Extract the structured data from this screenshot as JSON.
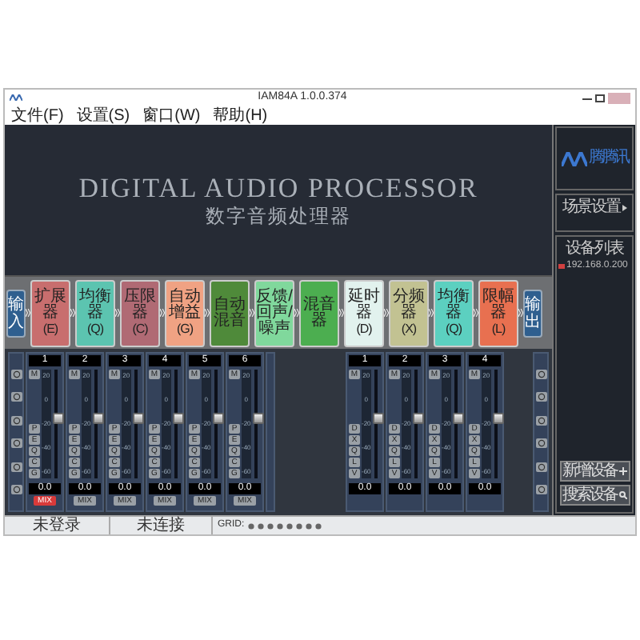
{
  "window": {
    "title": "IAM84A 1.0.0.374"
  },
  "menu": [
    "文件(F)",
    "设置(S)",
    "窗口(W)",
    "帮助(H)"
  ],
  "splash": {
    "title": "DIGITAL AUDIO PROCESSOR",
    "subtitle": "数字音频处理器"
  },
  "chain": [
    {
      "kind": "io",
      "label": "输入",
      "color": "#2f5f8f"
    },
    {
      "kind": "module",
      "label": "扩展器",
      "key": "(E)",
      "color": "#c86e6e"
    },
    {
      "kind": "module",
      "label": "均衡器",
      "key": "(Q)",
      "color": "#5cc4b0"
    },
    {
      "kind": "module",
      "label": "压限器",
      "key": "(C)",
      "color": "#b06a74"
    },
    {
      "kind": "module",
      "label": "自动增益",
      "key": "(G)",
      "color": "#f0a283"
    },
    {
      "kind": "module",
      "label": "自动混音",
      "color": "#4f8a3a"
    },
    {
      "kind": "module",
      "label": "反馈/回声/噪声",
      "color": "#80d89c"
    },
    {
      "kind": "module",
      "label": "混音器",
      "color": "#4cae50"
    },
    {
      "kind": "module",
      "label": "延时器",
      "key": "(D)",
      "color": "#e2f2ee"
    },
    {
      "kind": "module",
      "label": "分频器",
      "key": "(X)",
      "color": "#c2c292"
    },
    {
      "kind": "module",
      "label": "均衡器",
      "key": "(Q)",
      "color": "#5cd0c0"
    },
    {
      "kind": "module",
      "label": "限幅器",
      "key": "(L)",
      "color": "#e87050"
    },
    {
      "kind": "io",
      "label": "输出",
      "color": "#2f5f8f"
    }
  ],
  "inputs": [
    {
      "number": "1",
      "mute": "M",
      "scale": [
        "20",
        "0",
        "-20",
        "-40",
        "-60"
      ],
      "buttons": [
        "P",
        "E",
        "Q",
        "C",
        "G"
      ],
      "level": 0.55,
      "value": "0.0",
      "mix": "MIX",
      "mix_on": true
    },
    {
      "number": "2",
      "mute": "M",
      "scale": [
        "20",
        "0",
        "-20",
        "-40",
        "-60"
      ],
      "buttons": [
        "P",
        "E",
        "Q",
        "C",
        "G"
      ],
      "level": 0.55,
      "value": "0.0",
      "mix": "MIX",
      "mix_on": false
    },
    {
      "number": "3",
      "mute": "M",
      "scale": [
        "20",
        "0",
        "-20",
        "-40",
        "-60"
      ],
      "buttons": [
        "P",
        "E",
        "Q",
        "C",
        "G"
      ],
      "level": 0.55,
      "value": "0.0",
      "mix": "MIX",
      "mix_on": false
    },
    {
      "number": "4",
      "mute": "M",
      "scale": [
        "20",
        "0",
        "-20",
        "-40",
        "-60"
      ],
      "buttons": [
        "P",
        "E",
        "Q",
        "C",
        "G"
      ],
      "level": 0.55,
      "value": "0.0",
      "mix": "MIX",
      "mix_on": false
    },
    {
      "number": "5",
      "mute": "M",
      "scale": [
        "20",
        "0",
        "-20",
        "-40",
        "-60"
      ],
      "buttons": [
        "P",
        "E",
        "Q",
        "C",
        "G"
      ],
      "level": 0.55,
      "value": "0.0",
      "mix": "MIX",
      "mix_on": false
    },
    {
      "number": "6",
      "mute": "M",
      "scale": [
        "20",
        "0",
        "-20",
        "-40",
        "-60"
      ],
      "buttons": [
        "P",
        "E",
        "Q",
        "C",
        "G"
      ],
      "level": 0.55,
      "value": "0.0",
      "mix": "MIX",
      "mix_on": false
    }
  ],
  "outputs": [
    {
      "number": "1",
      "mute": "M",
      "scale": [
        "20",
        "0",
        "-20",
        "-40",
        "-60"
      ],
      "buttons": [
        "D",
        "X",
        "Q",
        "L",
        "V"
      ],
      "level": 0.55,
      "value": "0.0"
    },
    {
      "number": "2",
      "mute": "M",
      "scale": [
        "20",
        "0",
        "-20",
        "-40",
        "-60"
      ],
      "buttons": [
        "D",
        "X",
        "Q",
        "L",
        "V"
      ],
      "level": 0.55,
      "value": "0.0"
    },
    {
      "number": "3",
      "mute": "M",
      "scale": [
        "20",
        "0",
        "-20",
        "-40",
        "-60"
      ],
      "buttons": [
        "D",
        "X",
        "Q",
        "L",
        "V"
      ],
      "level": 0.55,
      "value": "0.0"
    },
    {
      "number": "4",
      "mute": "M",
      "scale": [
        "20",
        "0",
        "-20",
        "-40",
        "-60"
      ],
      "buttons": [
        "D",
        "X",
        "Q",
        "L",
        "V"
      ],
      "level": 0.55,
      "value": "0.0"
    }
  ],
  "sidebar": {
    "logo_text": "腾腾讯",
    "scene": "场景设置",
    "device_list_title": "设备列表",
    "devices": [
      {
        "ip": "192.168.0.200"
      }
    ],
    "buttons": [
      "新增设备",
      "搜索设备"
    ]
  },
  "status_bar": {
    "login": "未登录",
    "connection": "未连接",
    "grid_label": "GRID:"
  }
}
